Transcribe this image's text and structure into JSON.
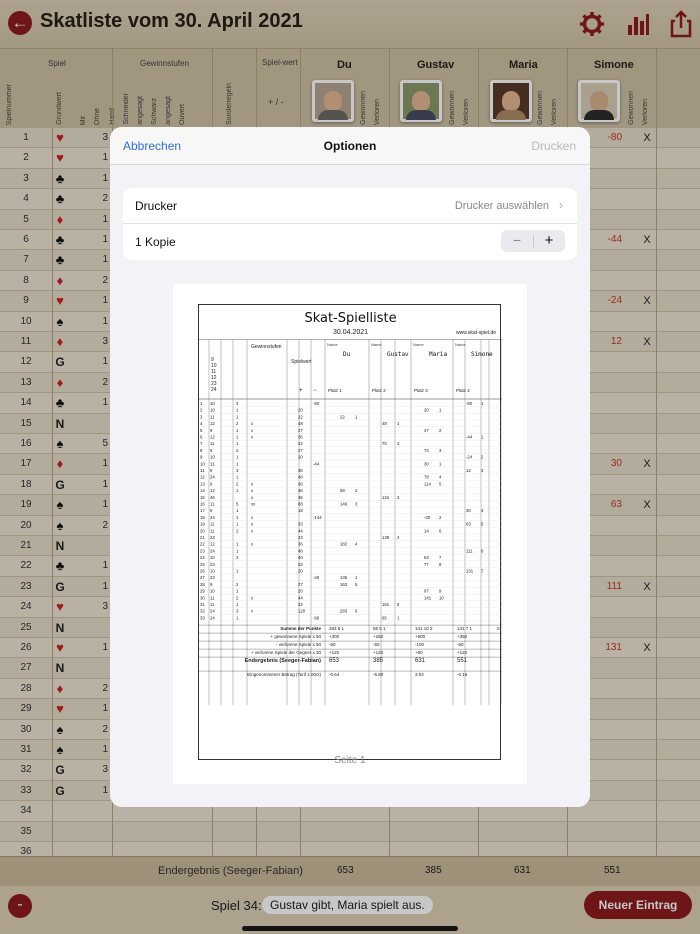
{
  "header": {
    "title": "Skatliste vom 30. April 2021",
    "back_icon": "back-arrow-icon",
    "icons": [
      "gear-icon",
      "bar-chart-icon",
      "share-icon"
    ],
    "accent": "#8e1b1e"
  },
  "columns": {
    "spiel": "Spiel",
    "gewinnstufen": "Gewinnstufen",
    "spielwert": "Spiel-wert",
    "spielnummer": "Spielnummer",
    "grundwert": "Grundwert",
    "mit": "Mit",
    "ohne": "Ohne",
    "hand": "Hand",
    "schneider": "Schneider",
    "angesagt": "angesagt",
    "schwarz": "Schwarz",
    "angesagt2": "angesagt",
    "ouvert": "Ouvert",
    "sonderregeln": "Sonderregeln",
    "plusminus": "+ / -",
    "gewonnen": "Gewonnen",
    "verloren": "Verloren"
  },
  "players": [
    {
      "name": "Du",
      "avatar": "avatar-du"
    },
    {
      "name": "Gustav",
      "avatar": "avatar-gustav"
    },
    {
      "name": "Maria",
      "avatar": "avatar-maria"
    },
    {
      "name": "Simone",
      "avatar": "avatar-simone"
    }
  ],
  "rows": [
    {
      "n": "1",
      "suit": "♥",
      "color": "red",
      "m": "3",
      "v": "-80",
      "x": "X"
    },
    {
      "n": "2",
      "suit": "♥",
      "color": "red",
      "m": "1",
      "v": "",
      "x": ""
    },
    {
      "n": "3",
      "suit": "♣",
      "color": "black",
      "m": "1",
      "v": "",
      "x": ""
    },
    {
      "n": "4",
      "suit": "♣",
      "color": "black",
      "m": "2",
      "v": "",
      "x": ""
    },
    {
      "n": "5",
      "suit": "♦",
      "color": "red",
      "m": "1",
      "v": "",
      "x": ""
    },
    {
      "n": "6",
      "suit": "♣",
      "color": "black",
      "m": "1",
      "v": "-44",
      "x": "X"
    },
    {
      "n": "7",
      "suit": "♣",
      "color": "black",
      "m": "1",
      "v": "",
      "x": ""
    },
    {
      "n": "8",
      "suit": "♦",
      "color": "red",
      "m": "2",
      "v": "",
      "x": ""
    },
    {
      "n": "9",
      "suit": "♥",
      "color": "red",
      "m": "1",
      "v": "-24",
      "x": "X"
    },
    {
      "n": "10",
      "suit": "♠",
      "color": "black",
      "m": "1",
      "v": "",
      "x": ""
    },
    {
      "n": "11",
      "suit": "♦",
      "color": "red",
      "m": "3",
      "v": "12",
      "x": "X"
    },
    {
      "n": "12",
      "suit": "G",
      "color": "txt",
      "m": "1",
      "v": "",
      "x": ""
    },
    {
      "n": "13",
      "suit": "♦",
      "color": "red",
      "m": "2",
      "v": "",
      "x": ""
    },
    {
      "n": "14",
      "suit": "♣",
      "color": "black",
      "m": "1",
      "v": "",
      "x": ""
    },
    {
      "n": "15",
      "suit": "N",
      "color": "txt",
      "m": "",
      "v": "",
      "x": ""
    },
    {
      "n": "16",
      "suit": "♠",
      "color": "black",
      "m": "5",
      "v": "",
      "x": ""
    },
    {
      "n": "17",
      "suit": "♦",
      "color": "red",
      "m": "1",
      "v": "30",
      "x": "X"
    },
    {
      "n": "18",
      "suit": "G",
      "color": "txt",
      "m": "1",
      "v": "",
      "x": ""
    },
    {
      "n": "19",
      "suit": "♠",
      "color": "black",
      "m": "1",
      "v": "63",
      "x": "X"
    },
    {
      "n": "20",
      "suit": "♠",
      "color": "black",
      "m": "2",
      "v": "",
      "x": ""
    },
    {
      "n": "21",
      "suit": "N",
      "color": "txt",
      "m": "",
      "v": "",
      "x": ""
    },
    {
      "n": "22",
      "suit": "♣",
      "color": "black",
      "m": "1",
      "v": "",
      "x": ""
    },
    {
      "n": "23",
      "suit": "G",
      "color": "txt",
      "m": "1",
      "v": "111",
      "x": "X"
    },
    {
      "n": "24",
      "suit": "♥",
      "color": "red",
      "m": "3",
      "v": "",
      "x": ""
    },
    {
      "n": "25",
      "suit": "N",
      "color": "txt",
      "m": "",
      "v": "",
      "x": ""
    },
    {
      "n": "26",
      "suit": "♥",
      "color": "red",
      "m": "1",
      "v": "131",
      "x": "X"
    },
    {
      "n": "27",
      "suit": "N",
      "color": "txt",
      "m": "",
      "v": "",
      "x": ""
    },
    {
      "n": "28",
      "suit": "♦",
      "color": "red",
      "m": "2",
      "v": "",
      "x": ""
    },
    {
      "n": "29",
      "suit": "♥",
      "color": "red",
      "m": "1",
      "v": "",
      "x": ""
    },
    {
      "n": "30",
      "suit": "♠",
      "color": "black",
      "m": "2",
      "v": "",
      "x": ""
    },
    {
      "n": "31",
      "suit": "♠",
      "color": "black",
      "m": "1",
      "v": "",
      "x": ""
    },
    {
      "n": "32",
      "suit": "G",
      "color": "txt",
      "m": "3",
      "v": "",
      "x": ""
    },
    {
      "n": "33",
      "suit": "G",
      "color": "txt",
      "m": "1",
      "v": "",
      "x": ""
    },
    {
      "n": "34",
      "suit": "",
      "color": "txt",
      "m": "",
      "v": "",
      "x": ""
    },
    {
      "n": "35",
      "suit": "",
      "color": "txt",
      "m": "",
      "v": "",
      "x": ""
    },
    {
      "n": "36",
      "suit": "",
      "color": "txt",
      "m": "",
      "v": "",
      "x": ""
    }
  ],
  "totals": {
    "label": "Endergebnis (Seeger-Fabian)",
    "values": [
      "653",
      "385",
      "631",
      "551"
    ]
  },
  "bottom": {
    "minus": "-",
    "game_label": "Spiel 34:",
    "game_info": "Gustav gibt, Maria spielt aus.",
    "new_entry": "Neuer Eintrag"
  },
  "dialog": {
    "cancel": "Abbrechen",
    "title": "Optionen",
    "print": "Drucken",
    "printer_label": "Drucker",
    "printer_value": "Drucker auswählen",
    "copies": "1 Kopie",
    "stepper_minus": "−",
    "stepper_plus": "+",
    "page_label": "Seite 1"
  },
  "sheet": {
    "title": "Skat-Spielliste",
    "date": "30.04.2021",
    "url": "www.skat-spiel.de",
    "h_gewinnstufen": "Gewinnstufen",
    "h_spielwert": "Spielwert",
    "h_name": "Name",
    "h_grund": "9\n10\n11\n12\n23\n24",
    "players": [
      "Du",
      "Gustav",
      "Maria",
      "Simone"
    ],
    "places": [
      "Platz 1",
      "Platz 2",
      "Platz 3",
      "Platz 4"
    ],
    "plus": "+",
    "minus": "−",
    "rows": [
      [
        "1",
        "10",
        "3",
        "",
        "",
        "-80",
        "",
        "",
        "",
        "",
        "",
        "",
        "-80",
        "1"
      ],
      [
        "2",
        "10",
        "1",
        "",
        "20",
        "",
        "",
        "",
        "",
        "",
        "20",
        "1",
        "",
        ""
      ],
      [
        "3",
        "11",
        "1",
        "",
        "22",
        "",
        "22",
        "1",
        "",
        "",
        "",
        "",
        "",
        ""
      ],
      [
        "4",
        "12",
        "2",
        "x",
        "48",
        "",
        "",
        "",
        "48",
        "1",
        "",
        "",
        "",
        ""
      ],
      [
        "5",
        "9",
        "1",
        "x",
        "27",
        "",
        "",
        "",
        "",
        "",
        "47",
        "2",
        "",
        ""
      ],
      [
        "6",
        "12",
        "1",
        "x",
        "36",
        "",
        "",
        "",
        "",
        "",
        "",
        "",
        "-44",
        "1"
      ],
      [
        "7",
        "11",
        "1",
        "",
        "22",
        "",
        "",
        "",
        "70",
        "2",
        "",
        "",
        "",
        ""
      ],
      [
        "8",
        "9",
        "2",
        "",
        "27",
        "",
        "",
        "",
        "",
        "",
        "74",
        "3",
        "",
        ""
      ],
      [
        "9",
        "10",
        "1",
        "",
        "20",
        "",
        "",
        "",
        "",
        "",
        "",
        "",
        "-24",
        "2"
      ],
      [
        "10",
        "11",
        "1",
        "",
        "",
        "-44",
        "",
        "",
        "",
        "",
        "30",
        "1",
        "",
        ""
      ],
      [
        "11",
        "9",
        "3",
        "",
        "36",
        "",
        "",
        "",
        "",
        "",
        "",
        "",
        "12",
        "3"
      ],
      [
        "12",
        "24",
        "1",
        "",
        "48",
        "",
        "",
        "",
        "",
        "",
        "78",
        "4",
        "",
        ""
      ],
      [
        "13",
        "9",
        "2",
        "x",
        "36",
        "",
        "",
        "",
        "",
        "",
        "114",
        "5",
        "",
        ""
      ],
      [
        "14",
        "12",
        "1",
        "x",
        "36",
        "",
        "58",
        "2",
        "",
        "",
        "",
        "",
        "",
        ""
      ],
      [
        "15",
        "46",
        "",
        "x",
        "36",
        "",
        "",
        "",
        "116",
        "3",
        "",
        "",
        "",
        ""
      ],
      [
        "16",
        "11",
        "5",
        "xx",
        "88",
        "",
        "146",
        "3",
        "",
        "",
        "",
        "",
        "",
        ""
      ],
      [
        "17",
        "9",
        "1",
        "",
        "18",
        "",
        "",
        "",
        "",
        "",
        "",
        "",
        "30",
        "4"
      ],
      [
        "18",
        "24",
        "1",
        "x",
        "",
        "-144",
        "",
        "",
        "",
        "",
        "-30",
        "2",
        "",
        ""
      ],
      [
        "19",
        "11",
        "1",
        "x",
        "33",
        "",
        "",
        "",
        "",
        "",
        "",
        "",
        "63",
        "5"
      ],
      [
        "20",
        "11",
        "2",
        "x",
        "44",
        "",
        "",
        "",
        "",
        "",
        "14",
        "6",
        "",
        ""
      ],
      [
        "21",
        "23",
        "",
        "",
        "23",
        "",
        "",
        "",
        "139",
        "4",
        "",
        "",
        "",
        ""
      ],
      [
        "22",
        "12",
        "1",
        "x",
        "36",
        "",
        "182",
        "4",
        "",
        "",
        "",
        "",
        "",
        ""
      ],
      [
        "23",
        "24",
        "1",
        "",
        "48",
        "",
        "",
        "",
        "",
        "",
        "",
        "",
        "111",
        "6"
      ],
      [
        "24",
        "10",
        "3",
        "",
        "40",
        "",
        "",
        "",
        "",
        "",
        "54",
        "7",
        "",
        ""
      ],
      [
        "25",
        "23",
        "",
        "",
        "23",
        "",
        "",
        "",
        "",
        "",
        "77",
        "8",
        "",
        ""
      ],
      [
        "26",
        "10",
        "1",
        "",
        "20",
        "",
        "",
        "",
        "",
        "",
        "",
        "",
        "131",
        "7"
      ],
      [
        "27",
        "23",
        "",
        "",
        "",
        "-46",
        "136",
        "1",
        "",
        "",
        "",
        "",
        "",
        ""
      ],
      [
        "28",
        "9",
        "2",
        "",
        "27",
        "",
        "163",
        "5",
        "",
        "",
        "",
        "",
        "",
        ""
      ],
      [
        "29",
        "10",
        "1",
        "",
        "20",
        "",
        "",
        "",
        "",
        "",
        "97",
        "9",
        "",
        ""
      ],
      [
        "30",
        "11",
        "2",
        "x",
        "44",
        "",
        "",
        "",
        "",
        "",
        "141",
        "10",
        "",
        ""
      ],
      [
        "31",
        "11",
        "1",
        "",
        "22",
        "",
        "",
        "",
        "161",
        "5",
        "",
        "",
        "",
        ""
      ],
      [
        "32",
        "24",
        "3",
        "x",
        "120",
        "",
        "283",
        "6",
        "",
        "",
        "",
        "",
        "",
        ""
      ],
      [
        "33",
        "24",
        "1",
        "",
        "",
        "-96",
        "",
        "",
        "65",
        "1",
        "",
        "",
        "",
        ""
      ]
    ],
    "sum_label": "Summe der Punkte",
    "sums": [
      "283 6 1",
      "65 5 1",
      "141 10 2",
      "131 7 1",
      "0"
    ],
    "won_label": "+ gewonnene Spiele x 50",
    "won": [
      "+300",
      "+250",
      "+500",
      "+350"
    ],
    "lost_label": "- verlorene Spiele x 50",
    "lost": [
      "-50",
      "-50",
      "-100",
      "-50"
    ],
    "opp_label": "+ verlorene Spiele der Gegner x 30",
    "opp": [
      "+120",
      "+120",
      "+90",
      "+120"
    ],
    "end_label": "Endergebnis (Seeger-Fabian)",
    "end": [
      "653",
      "385",
      "631",
      "551"
    ],
    "bet_label": "Eingenommener Betrag (Tarif 1.00ct)",
    "bet": [
      "-0.64",
      "-6.80",
      "3.04",
      "-0.16"
    ]
  }
}
